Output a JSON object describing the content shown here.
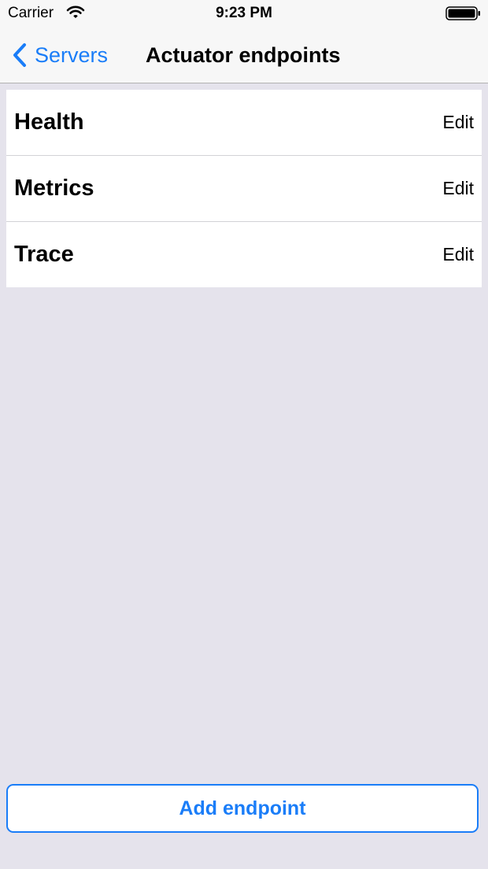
{
  "status_bar": {
    "carrier": "Carrier",
    "time": "9:23 PM"
  },
  "nav": {
    "back_label": "Servers",
    "title": "Actuator endpoints"
  },
  "endpoints": [
    {
      "name": "Health",
      "edit_label": "Edit"
    },
    {
      "name": "Metrics",
      "edit_label": "Edit"
    },
    {
      "name": "Trace",
      "edit_label": "Edit"
    }
  ],
  "footer": {
    "add_label": "Add endpoint"
  },
  "colors": {
    "accent": "#1a7df8",
    "background": "#e5e3ec",
    "nav_background": "#f7f7f7"
  },
  "icons": {
    "wifi": "wifi-icon",
    "battery": "battery-icon",
    "back": "chevron-left-icon"
  }
}
